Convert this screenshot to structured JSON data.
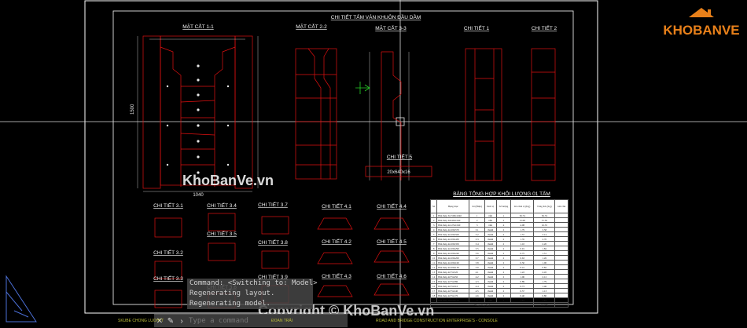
{
  "drawing": {
    "title": "CHI TIẾT TẤM VÁN KHUÔN ĐẦU DẦM",
    "section_1_1": "MẶT CẮT 1-1",
    "section_2_2": "MẶT CẮT 2-2",
    "section_3_3": "MẶT CẮT 3-3",
    "detail_1": "CHI TIẾT 1",
    "detail_2": "CHI TIẾT 2",
    "detail_5": "CHI TIẾT 5",
    "details_small": [
      "CHI TIẾT 3.1",
      "CHI TIẾT 3.2",
      "CHI TIẾT 3.3",
      "CHI TIẾT 3.4",
      "CHI TIẾT 3.5",
      "CHI TIẾT 3.6",
      "CHI TIẾT 3.7",
      "CHI TIẾT 3.8",
      "CHI TIẾT 3.9",
      "CHI TIẾT 4.1",
      "CHI TIẾT 4.2",
      "CHI TIẾT 4.3",
      "CHI TIẾT 4.4",
      "CHI TIẾT 4.5",
      "CHI TIẾT 4.6"
    ],
    "table_title": "BẢNG TỔNG HỢP KHỐI LƯỢNG 01 TẤM",
    "dim_1": "1500",
    "dim_2": "1040",
    "dim_3": "20x640x16"
  },
  "table": {
    "headers": [
      "Stt",
      "Hạng mục",
      "Kt (Hiệu)",
      "Đơn vị",
      "Số lượng",
      "KL/đơn vị (Kg)",
      "Tổng KL (Kg)",
      "Ghi chú"
    ],
    "rows": [
      [
        "1",
        "Bản thép 3x1500x1040",
        "1",
        "tấm",
        "1",
        "36.74",
        "36.74",
        ""
      ],
      [
        "2",
        "Bản thép 3x640x1040",
        "2",
        "tấm",
        "2",
        "15.68",
        "31.36",
        ""
      ],
      [
        "3",
        "Bản thép 4x125x1040",
        "3",
        "tấm",
        "4",
        "4.08",
        "16.33",
        ""
      ],
      [
        "4",
        "Bản thép 4x100x570",
        "3.1",
        "thanh",
        "2",
        "1.79",
        "3.58",
        ""
      ],
      [
        "5",
        "Bản thép 4x100x500",
        "3.2",
        "thanh",
        "2",
        "1.57",
        "3.14",
        ""
      ],
      [
        "6",
        "Bản thép 4x100x430",
        "3.3",
        "thanh",
        "2",
        "1.35",
        "2.70",
        ""
      ],
      [
        "7",
        "Bản thép 4x100x350",
        "3.4",
        "thanh",
        "2",
        "1.10",
        "2.20",
        ""
      ],
      [
        "8",
        "Bản thép 4x100x290",
        "3.5",
        "thanh",
        "2",
        "0.91",
        "1.82",
        ""
      ],
      [
        "9",
        "Bản thép 4x100x240",
        "3.6",
        "thanh",
        "2",
        "0.75",
        "1.51",
        ""
      ],
      [
        "10",
        "Bản thép 4x100x200",
        "3.7",
        "thanh",
        "2",
        "0.63",
        "1.26",
        ""
      ],
      [
        "11",
        "Bản thép 4x100x160",
        "3.8",
        "thanh",
        "2",
        "0.50",
        "1.00",
        ""
      ],
      [
        "12",
        "Bản thép 4x100x130",
        "3.9",
        "thanh",
        "2",
        "0.41",
        "0.82",
        ""
      ],
      [
        "13",
        "Bản thép 4x75x520",
        "4.1",
        "thanh",
        "2",
        "1.22",
        "2.45",
        ""
      ],
      [
        "14",
        "Bản thép 4x75x450",
        "4.2",
        "thanh",
        "2",
        "1.06",
        "2.12",
        ""
      ],
      [
        "15",
        "Bản thép 4x75x380",
        "4.3",
        "thanh",
        "2",
        "0.89",
        "1.79",
        ""
      ],
      [
        "16",
        "Bản thép 4x75x310",
        "4.4",
        "thanh",
        "2",
        "0.73",
        "1.46",
        ""
      ],
      [
        "17",
        "Bản thép 4x75x240",
        "4.5",
        "thanh",
        "2",
        "0.57",
        "1.13",
        ""
      ],
      [
        "18",
        "Bản thép 4x75x170",
        "4.6",
        "thanh",
        "2",
        "0.40",
        "0.80",
        ""
      ],
      [
        "19",
        "Bản thép 20x640x16",
        "5",
        "tấm",
        "1",
        "1.61",
        "1.61",
        ""
      ]
    ],
    "total_label": "Tổng cộng (kg)",
    "total_value": "104.79"
  },
  "command_line": {
    "history": [
      "Command: <Switching to: Model>",
      "Regenerating layout.",
      "Regenerating model."
    ],
    "placeholder": "Type a command",
    "close_icon": "close-icon",
    "wrench_icon": "wrench-icon"
  },
  "watermark": {
    "logo_text": "KHOBANVE",
    "center_text": "KhoBanVe.vn",
    "copyright": "Copyright © KhoBanVe.vn"
  },
  "status": {
    "left": "SKUBE CHONG LUOHTT",
    "model": "ĐOAN TRẢI",
    "road": "ROAD AND BRIDGE CONSTRUCTION ENTERPRISE'S - CONSOLE"
  },
  "colors": {
    "background": "#000000",
    "frame": "#ffffff",
    "drawing_red": "#e01010",
    "crosshair": "#ffffff",
    "logo_orange": "#e8801a",
    "ucs_blue": "#4b6fd6"
  }
}
